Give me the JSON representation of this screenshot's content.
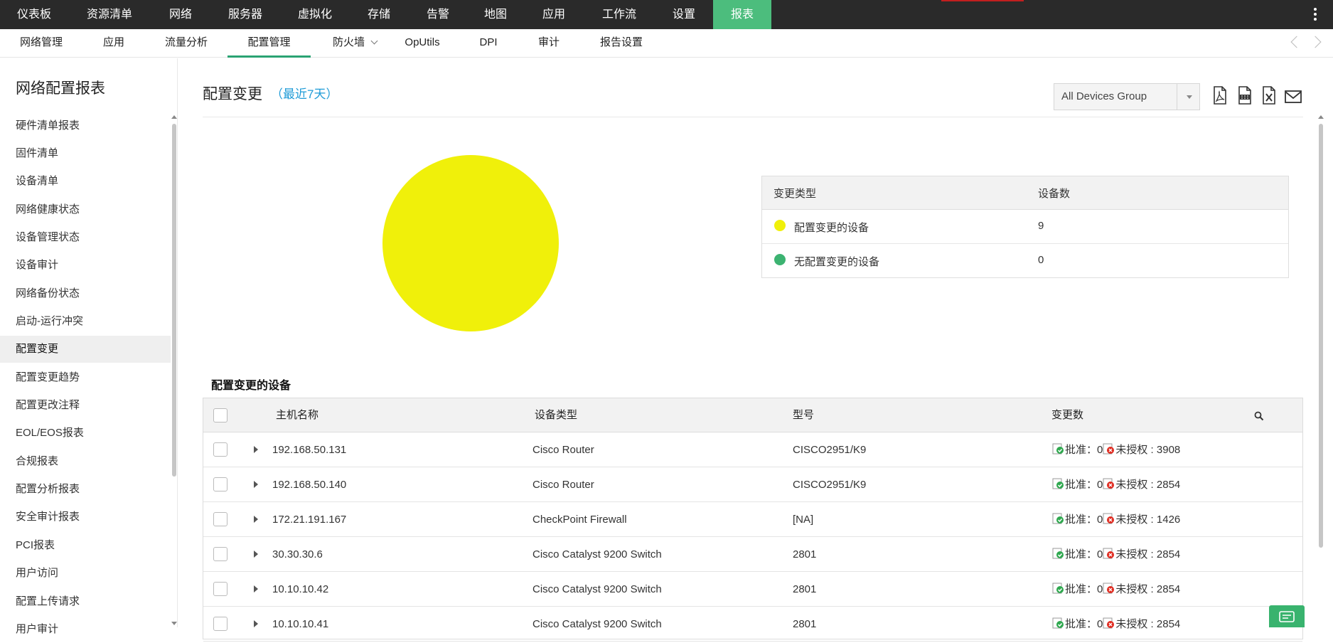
{
  "top_nav": {
    "items": [
      {
        "label": "仪表板"
      },
      {
        "label": "资源清单"
      },
      {
        "label": "网络"
      },
      {
        "label": "服务器"
      },
      {
        "label": "虚拟化"
      },
      {
        "label": "存储"
      },
      {
        "label": "告警"
      },
      {
        "label": "地图"
      },
      {
        "label": "应用"
      },
      {
        "label": "工作流"
      },
      {
        "label": "设置"
      },
      {
        "label": "报表"
      }
    ],
    "active": "报表"
  },
  "sub_nav": {
    "items": [
      {
        "label": "网络管理"
      },
      {
        "label": "应用"
      },
      {
        "label": "流量分析"
      },
      {
        "label": "配置管理"
      },
      {
        "label": "防火墙"
      },
      {
        "label": "OpUtils"
      },
      {
        "label": "DPI"
      },
      {
        "label": "审计"
      },
      {
        "label": "报告设置"
      }
    ],
    "active": "配置管理"
  },
  "sidebar": {
    "title": "网络配置报表",
    "items": [
      {
        "label": "硬件清单报表"
      },
      {
        "label": "固件清单"
      },
      {
        "label": "设备清单"
      },
      {
        "label": "网络健康状态"
      },
      {
        "label": "设备管理状态"
      },
      {
        "label": "设备审计"
      },
      {
        "label": "网络备份状态"
      },
      {
        "label": "启动-运行冲突"
      },
      {
        "label": "配置变更"
      },
      {
        "label": "配置变更趋势"
      },
      {
        "label": "配置更改注释"
      },
      {
        "label": "EOL/EOS报表"
      },
      {
        "label": "合规报表"
      },
      {
        "label": "配置分析报表"
      },
      {
        "label": "安全审计报表"
      },
      {
        "label": "PCI报表"
      },
      {
        "label": "用户访问"
      },
      {
        "label": "配置上传请求"
      },
      {
        "label": "用户审计"
      }
    ],
    "active": "配置变更"
  },
  "main": {
    "title": "配置变更",
    "subtitle": "（最近7天）",
    "group_select": "All Devices Group",
    "export_icons": [
      "pdf-export-icon",
      "csv-export-icon",
      "excel-export-icon",
      "email-icon"
    ]
  },
  "chart_data": {
    "type": "pie",
    "slices": [
      {
        "label": "配置变更的设备",
        "value": 9,
        "color": "#f0f00a"
      },
      {
        "label": "无配置变更的设备",
        "value": 0,
        "color": "#3cb371"
      }
    ]
  },
  "legend": {
    "col1": "变更类型",
    "col2": "设备数",
    "rows": [
      {
        "label": "配置变更的设备",
        "count": "9"
      },
      {
        "label": "无配置变更的设备",
        "count": "0"
      }
    ]
  },
  "devices": {
    "section_title": "配置变更的设备",
    "headers": {
      "host": "主机名称",
      "type": "设备类型",
      "model": "型号",
      "changes": "变更数"
    },
    "approved_label": "批准：",
    "unauth_label": "未授权",
    "rows": [
      {
        "host": "192.168.50.131",
        "type": "Cisco Router",
        "model": "CISCO2951/K9",
        "approved": "0",
        "unauthorized": "3908"
      },
      {
        "host": "192.168.50.140",
        "type": "Cisco Router",
        "model": "CISCO2951/K9",
        "approved": "0",
        "unauthorized": "2854"
      },
      {
        "host": "172.21.191.167",
        "type": "CheckPoint Firewall",
        "model": "[NA]",
        "approved": "0",
        "unauthorized": "1426"
      },
      {
        "host": "30.30.30.6",
        "type": "Cisco Catalyst 9200 Switch",
        "model": "2801",
        "approved": "0",
        "unauthorized": "2854"
      },
      {
        "host": "10.10.10.42",
        "type": "Cisco Catalyst 9200 Switch",
        "model": "2801",
        "approved": "0",
        "unauthorized": "2854"
      },
      {
        "host": "10.10.10.41",
        "type": "Cisco Catalyst 9200 Switch",
        "model": "2801",
        "approved": "0",
        "unauthorized": "2854"
      }
    ]
  }
}
